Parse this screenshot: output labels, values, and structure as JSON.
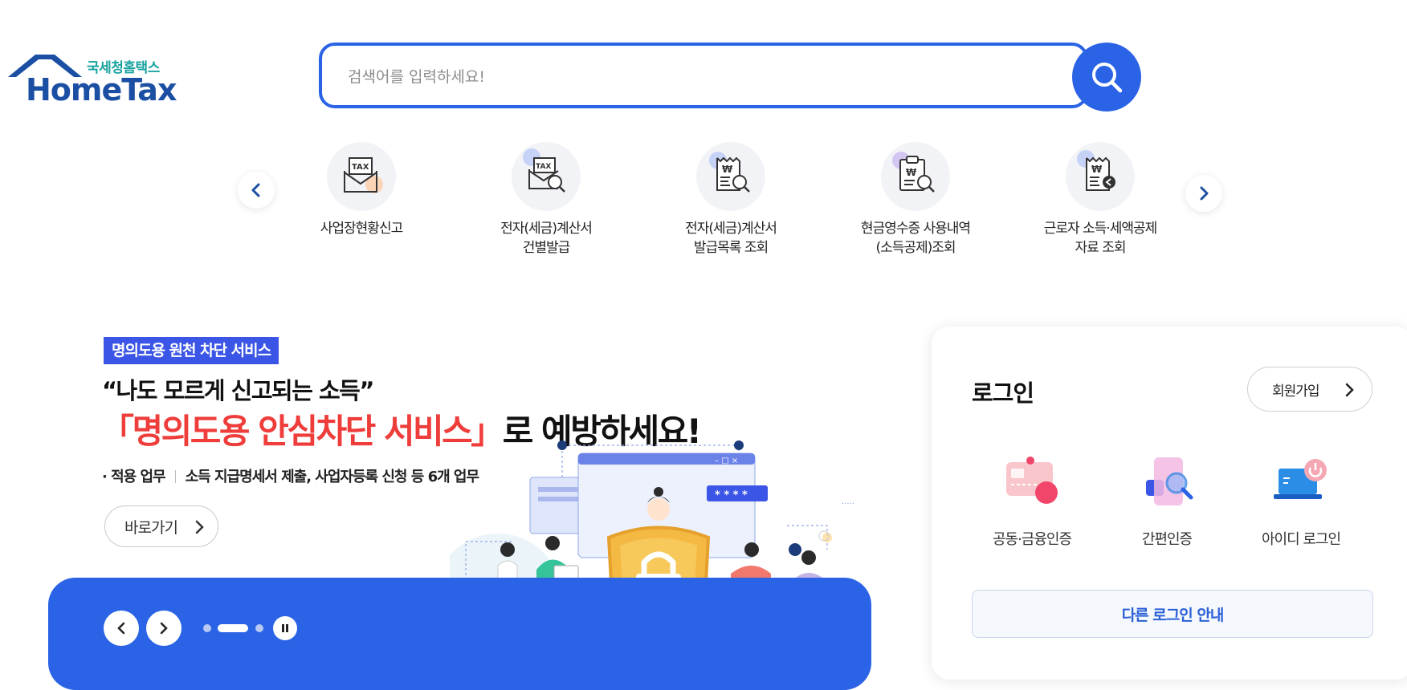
{
  "header": {
    "logo_sub": "국세청홈택스",
    "logo_main": "HomeTax",
    "search_placeholder": "검색어를 입력하세요!"
  },
  "quick_menu": {
    "items": [
      {
        "label": "사업장현황신고",
        "icon": "tax-envelope-icon"
      },
      {
        "label": "전자(세금)계산서\n건별발급",
        "icon": "tax-search-icon"
      },
      {
        "label": "전자(세금)계산서\n발급목록 조회",
        "icon": "receipt-search-icon"
      },
      {
        "label": "현금영수증 사용내역\n(소득공제)조회",
        "icon": "clipboard-search-icon"
      },
      {
        "label": "근로자 소득·세액공제\n자료 조회",
        "icon": "receipt-back-icon"
      }
    ]
  },
  "banner": {
    "tag": "명의도용 원천 차단 서비스",
    "quote": "“나도 모르게 신고되는 소득”",
    "headline_red": "「명의도용 안심차단 서비스」",
    "headline_black": "로 예방하세요!",
    "bullet_label": "· 적용 업무",
    "bullet_text": "소득 지급명세서 제출, 사업자등록 신청 등 6개 업무",
    "go_button": "바로가기",
    "password_mask": "* * * *",
    "window_controls": "– □ ×"
  },
  "login": {
    "title": "로그인",
    "signup": "회원가입",
    "options": [
      {
        "label": "공동·금융인증",
        "icon": "certificate-card-icon"
      },
      {
        "label": "간편인증",
        "icon": "phone-search-icon"
      },
      {
        "label": "아이디 로그인",
        "icon": "laptop-power-icon"
      }
    ],
    "other": "다른 로그인 안내"
  },
  "colors": {
    "primary": "#2a63e6",
    "tag_bg": "#3b55e6",
    "headline_red": "#ee3d3a",
    "logo_blue": "#1b4fa3",
    "logo_teal": "#1aa3a0"
  }
}
